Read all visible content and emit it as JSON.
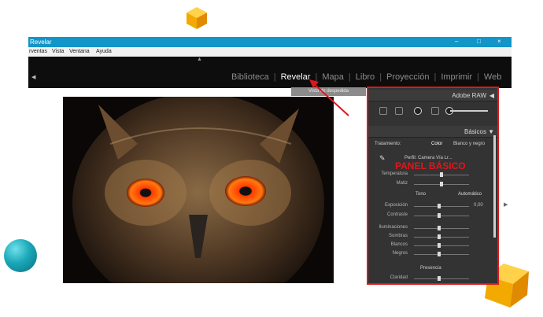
{
  "window": {
    "title": "Revelar",
    "controls": [
      "–",
      "□",
      "×"
    ]
  },
  "menu": [
    "rventas",
    "Vista",
    "Ventana",
    "Ayuda"
  ],
  "modules": {
    "items": [
      "Biblioteca",
      "Revelar",
      "Mapa",
      "Libro",
      "Proyección",
      "Imprimir",
      "Web"
    ],
    "active_index": 1
  },
  "tooltip": "Vista de despedida",
  "panel": {
    "header": "Adobe RAW",
    "section": "Básicos",
    "tabs": [
      "Tratamiento:",
      "Color",
      "Blanco y negro"
    ],
    "profile_row": "Perfil:  Camera Vía Lr...",
    "annotation": "PANEL BÁSICO",
    "wb_sliders": [
      {
        "label": "Temperatura",
        "value": "",
        "level": 0.5
      },
      {
        "label": "Matiz",
        "value": "",
        "level": 0.5
      }
    ],
    "tone_header": "Tono",
    "tone_auto": "Automático",
    "tone_sliders": [
      {
        "label": "Exposición",
        "value": "0,00",
        "level": 0.45
      },
      {
        "label": "Contraste",
        "value": "",
        "level": 0.45
      }
    ],
    "detail_sliders": [
      {
        "label": "Iluminaciones",
        "value": "",
        "level": 0.45
      },
      {
        "label": "Sombras",
        "value": "",
        "level": 0.45
      },
      {
        "label": "Blancos",
        "value": "",
        "level": 0.45
      },
      {
        "label": "Negros",
        "value": "",
        "level": 0.45
      }
    ],
    "presence_header": "Presencia",
    "presence_sliders": [
      {
        "label": "Claridad",
        "value": "",
        "level": 0.45
      }
    ]
  },
  "colors": {
    "titlebar": "#1295c8",
    "annotation_red": "#e0161b",
    "active_module": "#ffffff",
    "inactive_module": "#8c8c8c"
  },
  "icons": [
    "cube-icon",
    "sphere-icon",
    "arrow-icon",
    "triangle-icon"
  ]
}
